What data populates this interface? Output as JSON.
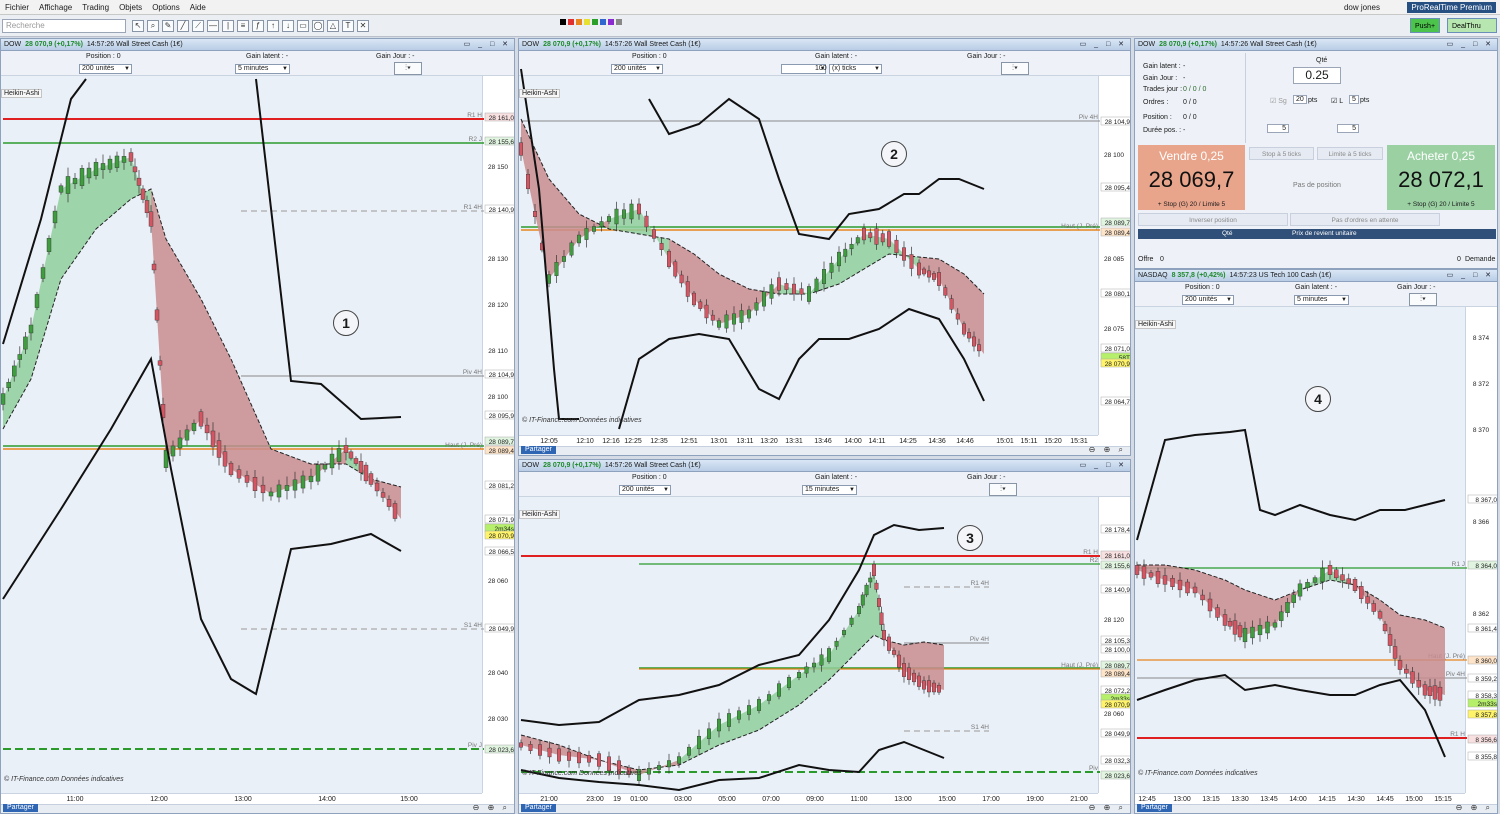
{
  "menu": {
    "items": [
      "Fichier",
      "Affichage",
      "Trading",
      "Objets",
      "Options",
      "Aide"
    ],
    "user": "dow jones",
    "product": "ProRealTime Premium"
  },
  "toolbar": {
    "search_placeholder": "Recherche",
    "push_label": "Push+",
    "dealthru_label": "DealThru"
  },
  "panel1": {
    "title_instr": "DOW",
    "title_price": "28 070,9 (+0,17%)",
    "title_time": "14:57:26",
    "title_name": "Wall Street Cash (1€)",
    "position_label": "Position : 0",
    "gain_latent": "Gain latent : -",
    "gain_jour": "Gain Jour : -",
    "qty": "200 unités",
    "timeframe": "5 minutes",
    "indicator": "Heikin-Ashi",
    "circle": "1",
    "credit": "© IT-Finance.com  Données indicatives",
    "share_label": "Partager",
    "y_labels": [
      "28 150",
      "28 130",
      "28 120",
      "28 110",
      "28 100",
      "28 060",
      "28 040",
      "28 030"
    ],
    "tags": [
      "28 161,0",
      "28 155,6",
      "28 140,9",
      "28 104,9",
      "28 095,9",
      "28 089,7",
      "28 089,4",
      "28 081,2",
      "28 071,9",
      "2m34s",
      "28 070,9",
      "28 066,5",
      "28 049,9",
      "28 023,6"
    ],
    "x_labels": [
      "11:00",
      "12:00",
      "13:00",
      "14:00",
      "15:00"
    ],
    "lines": {
      "r1": "R1 H",
      "r2": "R2 J",
      "r1_4h": "R1 4H",
      "piv_4h": "Piv 4H",
      "haut": "Haut (J. Pré)",
      "s1_4h": "S1 4H",
      "piv": "Piv J"
    }
  },
  "panel2": {
    "title_instr": "DOW",
    "title_price": "28 070,9 (+0,17%)",
    "title_time": "14:57:26",
    "title_name": "Wall Street Cash (1€)",
    "position_label": "Position : 0",
    "gain_latent": "Gain latent : -",
    "gain_jour": "Gain Jour : -",
    "qty": "200 unités",
    "ticks": "100",
    "ticks_unit": "(x) ticks",
    "indicator": "Heikin-Ashi",
    "circle": "2",
    "credit": "© IT-Finance.com  Données indicatives",
    "share_label": "Partager",
    "y_labels": [
      "28 100",
      "28 085",
      "28 075"
    ],
    "tags": [
      "28 104,9",
      "28 095,4",
      "28 089,7",
      "28 089,4",
      "28 080,1",
      "28 071,0",
      "58T",
      "28 070,9",
      "28 064,7"
    ],
    "x_labels": [
      "12:05",
      "12:10",
      "12:16",
      "12:25",
      "12:35",
      "12:51",
      "13:01",
      "13:11",
      "13:20",
      "13:31",
      "13:46",
      "14:00",
      "14:11",
      "14:25",
      "14:36",
      "14:46",
      "15:01",
      "15:11",
      "15:20",
      "15:31"
    ],
    "lines": {
      "piv_4h": "Piv 4H",
      "haut": "Haut (J. Pré)"
    }
  },
  "panel3": {
    "title_instr": "DOW",
    "title_price": "28 070,9 (+0,17%)",
    "title_time": "14:57:26",
    "title_name": "Wall Street Cash (1€)",
    "position_label": "Position : 0",
    "gain_latent": "Gain latent : -",
    "gain_jour": "Gain Jour : -",
    "qty": "200 unités",
    "timeframe": "15 minutes",
    "indicator": "Heikin-Ashi",
    "circle": "3",
    "credit": "© IT-Finance.com  Données indicatives",
    "share_label": "Partager",
    "y_labels": [
      "28 120",
      "28 060",
      "28 040"
    ],
    "tags": [
      "28 178,4",
      "28 161,0",
      "28 155,6",
      "28 140,9",
      "28 105,3",
      "28 100,0",
      "28 089,7",
      "28 089,4",
      "28 072,2",
      "2m33s",
      "28 070,9",
      "28 049,9",
      "28 032,3",
      "28 023,6"
    ],
    "x_labels": [
      "21:00",
      "23:00",
      "19",
      "01:00",
      "03:00",
      "05:00",
      "07:00",
      "09:00",
      "11:00",
      "13:00",
      "15:00",
      "17:00",
      "19:00",
      "21:00"
    ],
    "lines": {
      "r1": "R1 H",
      "r2": "R2",
      "r1_4h": "R1 4H",
      "piv_4h": "Piv 4H",
      "haut": "Haut (J. Pré)",
      "s1_4h": "S1 4H",
      "piv": "Piv"
    }
  },
  "panel4": {
    "title_instr": "NASDAQ",
    "title_price": "8 357,8 (+0,42%)",
    "title_time": "14:57:23",
    "title_name": "US Tech 100 Cash (1€)",
    "position_label": "Position : 0",
    "gain_latent": "Gain latent : -",
    "gain_jour": "Gain Jour : -",
    "qty": "200 unités",
    "timeframe": "5 minutes",
    "indicator": "Heikin-Ashi",
    "circle": "4",
    "credit": "© IT-Finance.com  Données indicatives",
    "share_label": "Partager",
    "y_labels": [
      "8 374",
      "8 372",
      "8 370",
      "8 366",
      "8 362"
    ],
    "tags": [
      "8 367,0",
      "8 364,0",
      "8 361,4",
      "8 360,0",
      "8 359,2",
      "8 358,3",
      "2m33s",
      "8 357,8",
      "8 356,6",
      "8 355,8"
    ],
    "x_labels": [
      "12:45",
      "13:00",
      "13:15",
      "13:30",
      "13:45",
      "14:00",
      "14:15",
      "14:30",
      "14:45",
      "15:00",
      "15:15"
    ],
    "lines": {
      "r1": "R1 J",
      "haut": "Haut (J. Pré)",
      "piv_4h": "Piv 4H",
      "r1_h": "R1 H"
    }
  },
  "trade": {
    "title_instr": "DOW",
    "title_price": "28 070,9 (+0,17%)",
    "title_time": "14:57:26",
    "title_name": "Wall Street Cash (1€)",
    "gain_latent": "Gain latent :",
    "gain_latent_v": "-",
    "gain_jour": "Gain Jour :",
    "gain_jour_v": "-",
    "trades_jour": "Trades jour :",
    "trades_jour_v": "0 / 0 / 0",
    "ordres": "Ordres :",
    "ordres_v": "0 / 0",
    "position": "Position :",
    "position_v": "0 / 0",
    "duree": "Durée pos. :",
    "duree_v": "-",
    "qty_label": "Qté",
    "qty_value": "0.25",
    "sg": "Sg",
    "sg_pts": "20",
    "sg_unit": "pts",
    "l_label": "L",
    "l_pts": "5",
    "l_unit": "pts",
    "step1": "5",
    "step2": "5",
    "sell_label": "Vendre 0,25",
    "sell_price": "28 069,7",
    "sell_sub": "+ Stop (G) 20 / Limite 5",
    "buy_label": "Acheter 0,25",
    "buy_price": "28 072,1",
    "buy_sub": "+ Stop (G) 20 / Limite 5",
    "stop_btn": "Stop à 5 ticks",
    "limit_btn": "Limite à 5 ticks",
    "no_position": "Pas de position",
    "invert": "Inverser position",
    "no_orders": "Pas d'ordres en attente",
    "col_qty": "Qté",
    "col_price": "Prix de revient unitaire",
    "offre": "Offre",
    "offre_v": "0",
    "demande": "Demande",
    "demande_v": "0"
  },
  "colors": {
    "up": "#3f9c3f",
    "down": "#d45662",
    "fill_up": "#8fcf9c",
    "fill_down": "#c98c8f",
    "red_line": "#e02020",
    "green_line": "#2a9a2a",
    "orange_line": "#e8851e"
  }
}
